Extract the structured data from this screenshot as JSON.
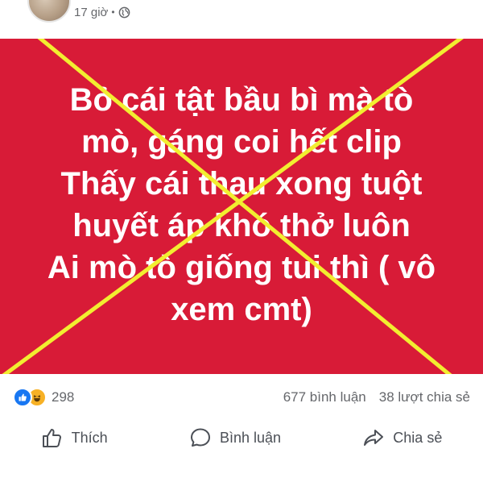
{
  "post": {
    "time": "17 giờ",
    "separator": "•",
    "image_text_lines": [
      "Bỏ cái tật bầu bì mà tò",
      "mò, gáng coi hết clip",
      "Thấy cái thau xong tuột",
      "huyết áp khó thở luôn",
      "Ai mò tò giống tui thì ( vô",
      "xem cmt)"
    ],
    "background_color": "#d81b37",
    "cross_color": "#f2ee30"
  },
  "stats": {
    "reaction_count": "298",
    "comments": "677 bình luận",
    "shares": "38 lượt chia sẻ"
  },
  "actions": {
    "like": "Thích",
    "comment": "Bình luận",
    "share": "Chia sẻ"
  }
}
